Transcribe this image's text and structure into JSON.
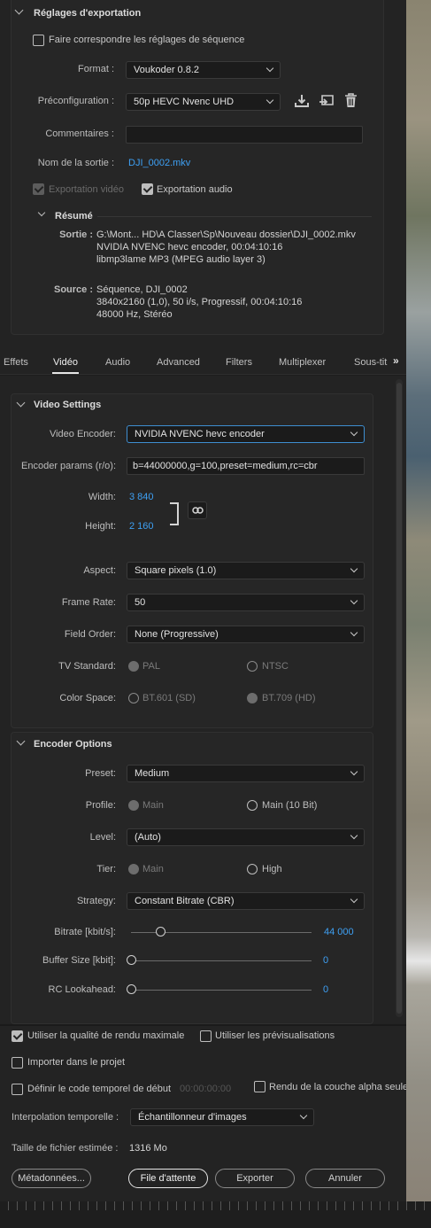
{
  "export_settings": {
    "section_title": "Réglages d'exportation",
    "match_sequence_label": "Faire correspondre les réglages de séquence",
    "format_label": "Format :",
    "format_value": "Voukoder 0.8.2",
    "preset_label": "Préconfiguration :",
    "preset_value": "50p HEVC Nvenc UHD",
    "comments_label": "Commentaires :",
    "comments_value": "",
    "output_name_label": "Nom de la sortie :",
    "output_name_value": "DJI_0002.mkv",
    "export_video_label": "Exportation vidéo",
    "export_audio_label": "Exportation audio"
  },
  "summary": {
    "title": "Résumé",
    "output_label": "Sortie :",
    "output_lines": [
      "G:\\Mont... HD\\A Classer\\Sp\\Nouveau dossier\\DJI_0002.mkv",
      "NVIDIA NVENC hevc encoder, 00:04:10:16",
      "libmp3lame MP3 (MPEG audio layer 3)"
    ],
    "source_label": "Source :",
    "source_lines": [
      "Séquence, DJI_0002",
      "3840x2160 (1,0), 50  i/s, Progressif, 00:04:10:16",
      "48000 Hz, Stéréo"
    ]
  },
  "tabs": [
    "Effets",
    "Vidéo",
    "Audio",
    "Advanced",
    "Filters",
    "Multiplexer",
    "Sous-tit"
  ],
  "tabs_overflow_icon": "double-chevron-right-icon",
  "video_settings": {
    "title": "Video Settings",
    "encoder_label": "Video Encoder:",
    "encoder_value": "NVIDIA NVENC hevc encoder",
    "params_label": "Encoder params (r/o):",
    "params_value": "b=44000000,g=100,preset=medium,rc=cbr",
    "width_label": "Width:",
    "width_value": "3 840",
    "height_label": "Height:",
    "height_value": "2 160",
    "aspect_label": "Aspect:",
    "aspect_value": "Square pixels (1.0)",
    "framerate_label": "Frame Rate:",
    "framerate_value": "50",
    "fieldorder_label": "Field Order:",
    "fieldorder_value": "None (Progressive)",
    "tvstandard_label": "TV Standard:",
    "tvstandard_options": [
      "PAL",
      "NTSC"
    ],
    "colorspace_label": "Color Space:",
    "colorspace_options": [
      "BT.601 (SD)",
      "BT.709 (HD)"
    ]
  },
  "encoder_options": {
    "title": "Encoder Options",
    "preset_label": "Preset:",
    "preset_value": "Medium",
    "profile_label": "Profile:",
    "profile_options": [
      "Main",
      "Main (10 Bit)"
    ],
    "level_label": "Level:",
    "level_value": "(Auto)",
    "tier_label": "Tier:",
    "tier_options": [
      "Main",
      "High"
    ],
    "strategy_label": "Strategy:",
    "strategy_value": "Constant Bitrate (CBR)",
    "bitrate_label": "Bitrate [kbit/s]:",
    "bitrate_value": "44 000",
    "bitrate_fraction": 0.16,
    "buffer_label": "Buffer Size [kbit]:",
    "buffer_value": "0",
    "lookahead_label": "RC Lookahead:",
    "lookahead_value": "0"
  },
  "footer": {
    "max_quality_label": "Utiliser la qualité de rendu maximale",
    "previews_label": "Utiliser les prévisualisations",
    "import_label": "Importer dans le projet",
    "timecode_label": "Définir le code temporel de début",
    "timecode_value": "00:00:00:00",
    "alpha_label": "Rendu de la couche alpha seule",
    "interp_label": "Interpolation temporelle :",
    "interp_value": "Échantillonneur d'images",
    "filesize_label": "Taille de fichier estimée :",
    "filesize_value": "1316 Mo",
    "metadata_button": "Métadonnées...",
    "queue_button": "File d'attente",
    "export_button": "Exporter",
    "cancel_button": "Annuler"
  },
  "colors": {
    "accent_blue": "#3ea0f4",
    "panel_bg": "#232323",
    "focus_border": "#3e8ed0"
  }
}
